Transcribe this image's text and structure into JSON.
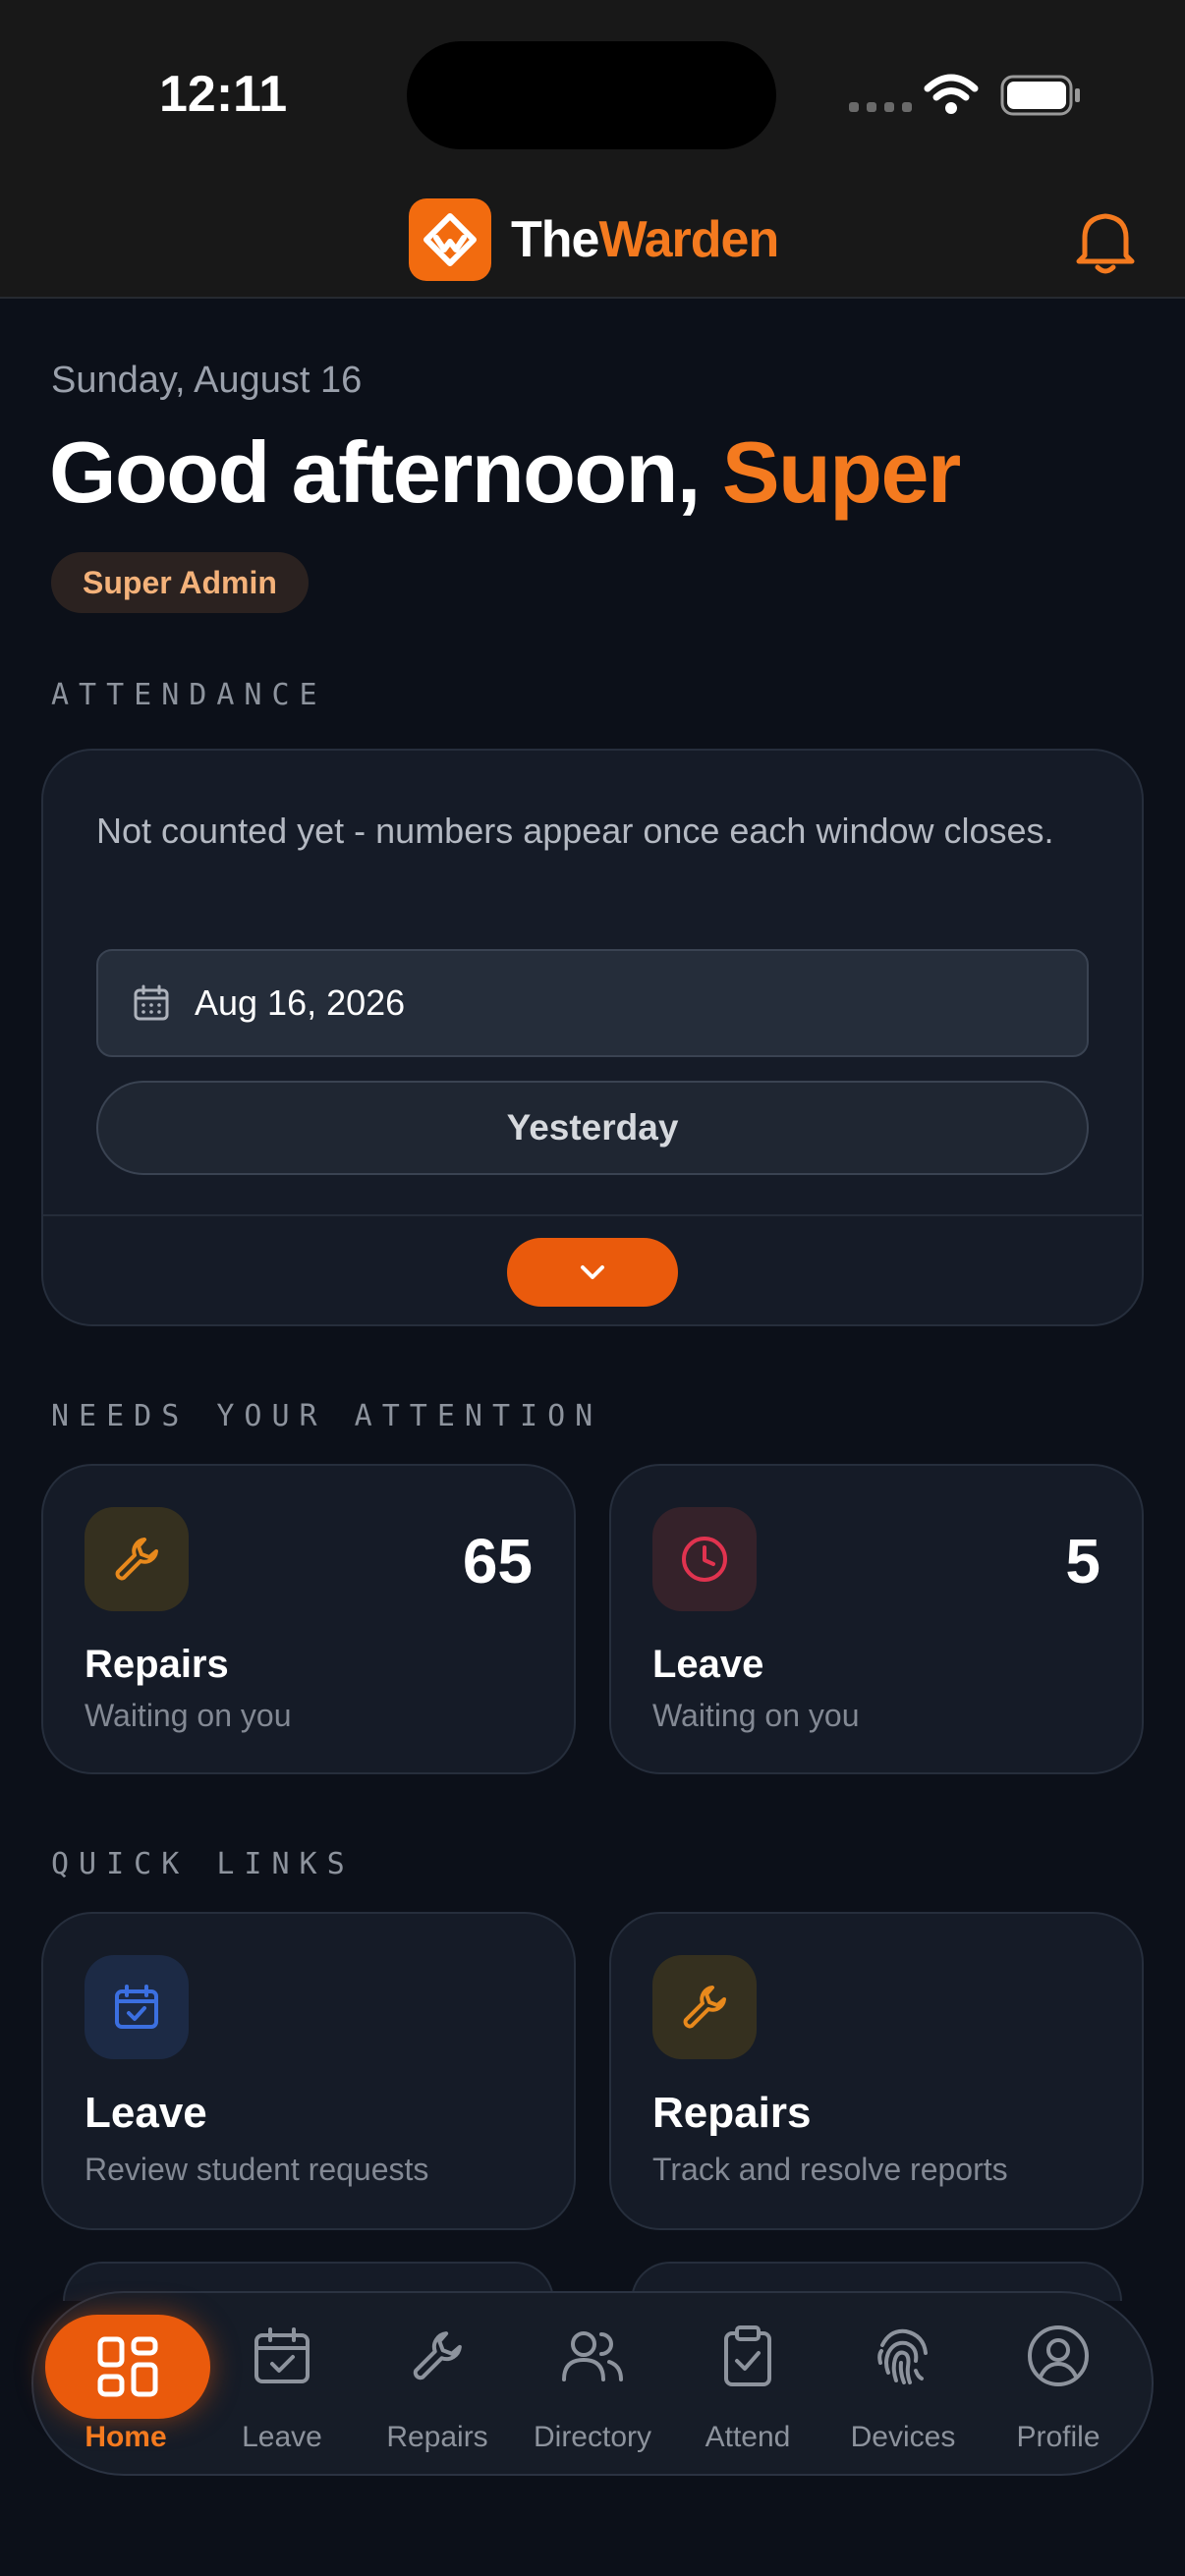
{
  "status_bar": {
    "time": "12:11"
  },
  "header": {
    "brand_part1": "The",
    "brand_part2": "Warden"
  },
  "greeting": {
    "date": "Sunday, August 16",
    "salutation": "Good afternoon,",
    "name": "Super",
    "role_badge": "Super Admin"
  },
  "attendance": {
    "section_title": "ATTENDANCE",
    "note": "Not counted yet - numbers appear once each window closes.",
    "date_value": "Aug 16, 2026",
    "yesterday_label": "Yesterday"
  },
  "attention": {
    "section_title": "NEEDS YOUR ATTENTION",
    "cards": [
      {
        "title": "Repairs",
        "subtitle": "Waiting on you",
        "count": "65",
        "icon": "wrench-icon",
        "color": "#e8891c"
      },
      {
        "title": "Leave",
        "subtitle": "Waiting on you",
        "count": "5",
        "icon": "clock-icon",
        "color": "#e0334f"
      }
    ]
  },
  "quick_links": {
    "section_title": "QUICK LINKS",
    "cards": [
      {
        "title": "Leave",
        "subtitle": "Review student requests",
        "icon": "calendar-check-icon",
        "color": "#3b6fe0"
      },
      {
        "title": "Repairs",
        "subtitle": "Track and resolve reports",
        "icon": "wrench-icon",
        "color": "#e8891c"
      }
    ]
  },
  "nav": {
    "items": [
      {
        "label": "Home",
        "icon": "home-grid-icon",
        "active": true
      },
      {
        "label": "Leave",
        "icon": "calendar-check-icon"
      },
      {
        "label": "Repairs",
        "icon": "wrench-icon"
      },
      {
        "label": "Directory",
        "icon": "users-icon"
      },
      {
        "label": "Attend",
        "icon": "clipboard-check-icon"
      },
      {
        "label": "Devices",
        "icon": "fingerprint-icon"
      },
      {
        "label": "Profile",
        "icon": "user-circle-icon"
      }
    ]
  },
  "colors": {
    "accent": "#f47a1f",
    "accent_strong": "#ea5a0c",
    "background": "#0c1019",
    "card": "#151b27"
  }
}
